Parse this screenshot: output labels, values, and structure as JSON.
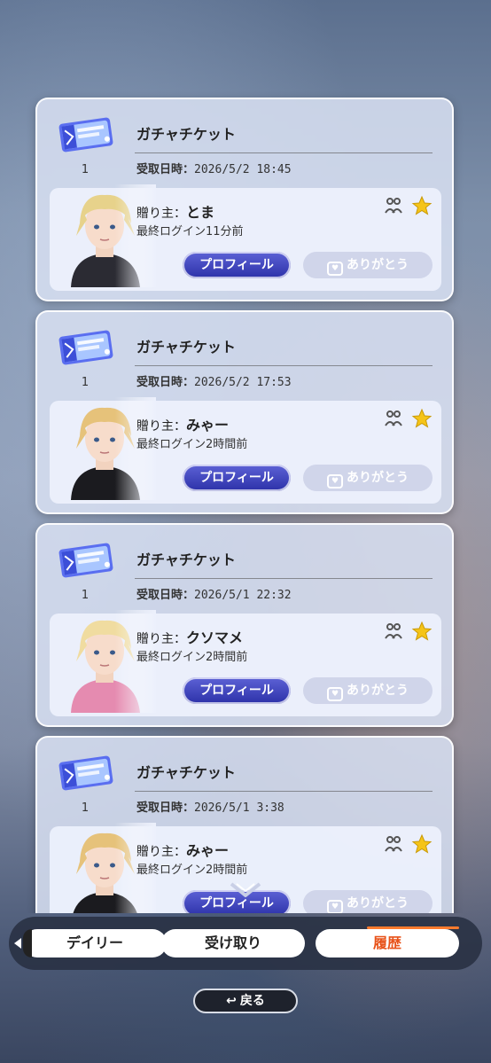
{
  "gifts": [
    {
      "item_name": "ガチャチケット",
      "quantity": "1",
      "received_label": "受取日時：",
      "received_at": "2026/5/2 18:45",
      "giver_label": "贈り主：",
      "giver_name": "とま",
      "last_login": "最終ログイン11分前",
      "profile_label": "プロフィール",
      "thanks_label": "ありがとう",
      "avatar_hair": "#e7d28b",
      "avatar_cloth": "#2b2b33"
    },
    {
      "item_name": "ガチャチケット",
      "quantity": "1",
      "received_label": "受取日時：",
      "received_at": "2026/5/2 17:53",
      "giver_label": "贈り主：",
      "giver_name": "みゃー",
      "last_login": "最終ログイン2時間前",
      "profile_label": "プロフィール",
      "thanks_label": "ありがとう",
      "avatar_hair": "#e6c27a",
      "avatar_cloth": "#1b1b1f"
    },
    {
      "item_name": "ガチャチケット",
      "quantity": "1",
      "received_label": "受取日時：",
      "received_at": "2026/5/1 22:32",
      "giver_label": "贈り主：",
      "giver_name": "クソマメ",
      "last_login": "最終ログイン2時間前",
      "profile_label": "プロフィール",
      "thanks_label": "ありがとう",
      "avatar_hair": "#f0dca0",
      "avatar_cloth": "#e58bb0"
    },
    {
      "item_name": "ガチャチケット",
      "quantity": "1",
      "received_label": "受取日時：",
      "received_at": "2026/5/1 3:38",
      "giver_label": "贈り主：",
      "giver_name": "みゃー",
      "last_login": "最終ログイン2時間前",
      "profile_label": "プロフィール",
      "thanks_label": "ありがとう",
      "avatar_hair": "#e6c27a",
      "avatar_cloth": "#1b1b1f"
    }
  ],
  "tabs": {
    "daily": "デイリー",
    "receive": "受け取り",
    "history": "履歴",
    "active": "history"
  },
  "back_label": "戻る",
  "colors": {
    "accent_orange": "#e8531a",
    "profile_button": "#3b40bd",
    "star": "#f5c418"
  }
}
